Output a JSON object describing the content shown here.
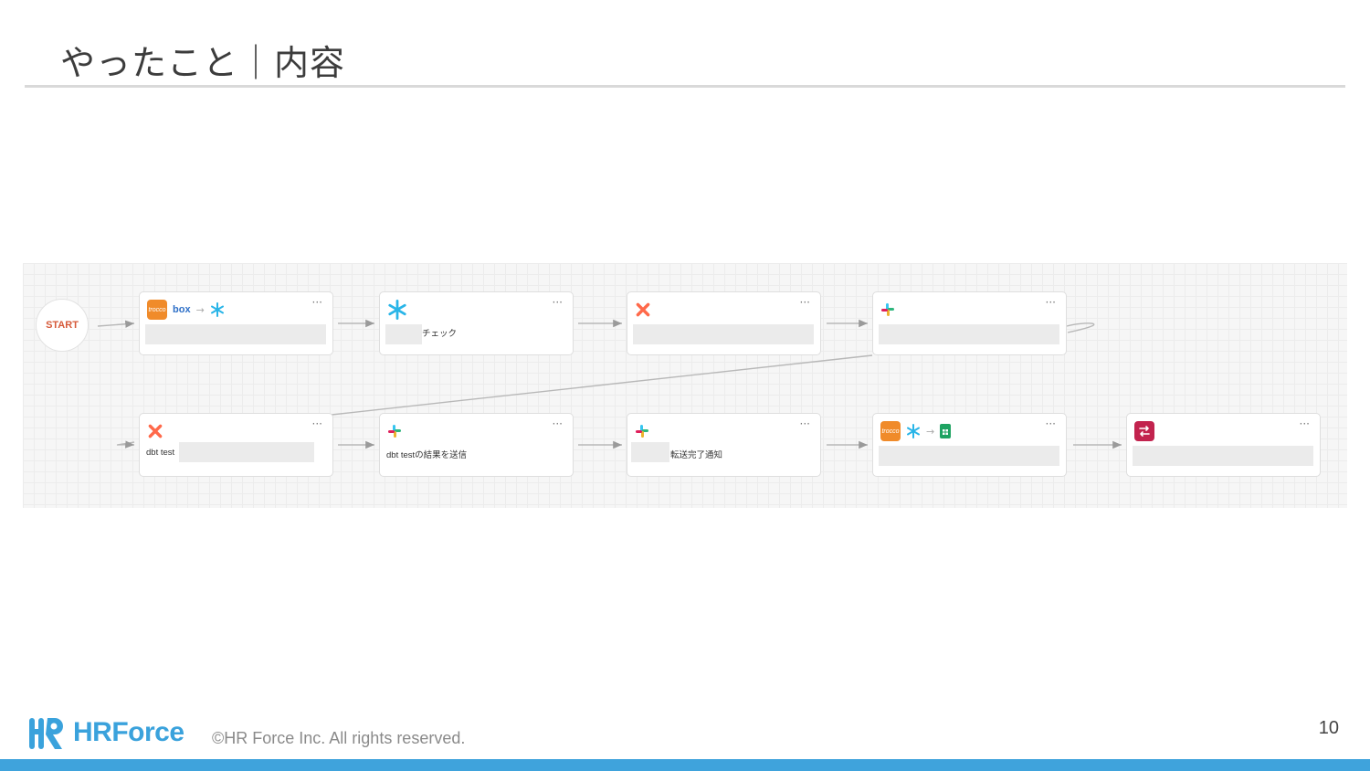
{
  "slide": {
    "title": "やったこと｜内容",
    "page_number": "10",
    "copyright": "©HR Force Inc. All rights reserved.",
    "logo_text": "HRForce"
  },
  "workflow": {
    "start_label": "START",
    "menu_glyph": "···",
    "nodes": [
      {
        "id": "n1",
        "icons": [
          "trocco-icon",
          "box-icon",
          "arrow-icon",
          "snowflake-icon"
        ],
        "trocco_label": "trocco",
        "box_label": "box",
        "label": ""
      },
      {
        "id": "n2",
        "icons": [
          "snowflake-icon"
        ],
        "label": "チェック"
      },
      {
        "id": "n3",
        "icons": [
          "dbt-icon"
        ],
        "label": ""
      },
      {
        "id": "n4",
        "icons": [
          "slack-icon"
        ],
        "label": ""
      },
      {
        "id": "n5",
        "icons": [
          "dbt-icon"
        ],
        "label": "dbt test"
      },
      {
        "id": "n6",
        "icons": [
          "slack-icon"
        ],
        "label": "dbt testの結果を送信"
      },
      {
        "id": "n7",
        "icons": [
          "slack-icon"
        ],
        "label": "転送完了通知"
      },
      {
        "id": "n8",
        "icons": [
          "trocco-icon",
          "snowflake-icon",
          "arrow-icon",
          "google-sheets-icon"
        ],
        "trocco_label": "trocco",
        "label": ""
      },
      {
        "id": "n9",
        "icons": [
          "workflow-icon"
        ],
        "label": ""
      }
    ]
  },
  "colors": {
    "accent_blue": "#3fa3dc",
    "trocco_orange": "#f08b2a",
    "dbt_orange": "#ff694a",
    "snowflake_blue": "#29b5e8",
    "workflow_red": "#c2234e"
  }
}
